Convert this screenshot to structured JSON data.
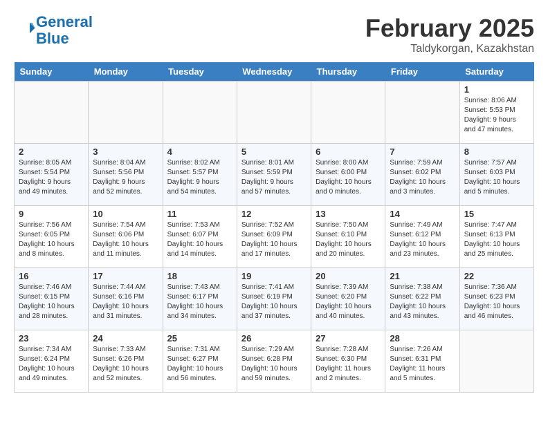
{
  "logo": {
    "line1": "General",
    "line2": "Blue"
  },
  "title": "February 2025",
  "subtitle": "Taldykorgan, Kazakhstan",
  "days_of_week": [
    "Sunday",
    "Monday",
    "Tuesday",
    "Wednesday",
    "Thursday",
    "Friday",
    "Saturday"
  ],
  "weeks": [
    [
      {
        "num": "",
        "info": ""
      },
      {
        "num": "",
        "info": ""
      },
      {
        "num": "",
        "info": ""
      },
      {
        "num": "",
        "info": ""
      },
      {
        "num": "",
        "info": ""
      },
      {
        "num": "",
        "info": ""
      },
      {
        "num": "1",
        "info": "Sunrise: 8:06 AM\nSunset: 5:53 PM\nDaylight: 9 hours and 47 minutes."
      }
    ],
    [
      {
        "num": "2",
        "info": "Sunrise: 8:05 AM\nSunset: 5:54 PM\nDaylight: 9 hours and 49 minutes."
      },
      {
        "num": "3",
        "info": "Sunrise: 8:04 AM\nSunset: 5:56 PM\nDaylight: 9 hours and 52 minutes."
      },
      {
        "num": "4",
        "info": "Sunrise: 8:02 AM\nSunset: 5:57 PM\nDaylight: 9 hours and 54 minutes."
      },
      {
        "num": "5",
        "info": "Sunrise: 8:01 AM\nSunset: 5:59 PM\nDaylight: 9 hours and 57 minutes."
      },
      {
        "num": "6",
        "info": "Sunrise: 8:00 AM\nSunset: 6:00 PM\nDaylight: 10 hours and 0 minutes."
      },
      {
        "num": "7",
        "info": "Sunrise: 7:59 AM\nSunset: 6:02 PM\nDaylight: 10 hours and 3 minutes."
      },
      {
        "num": "8",
        "info": "Sunrise: 7:57 AM\nSunset: 6:03 PM\nDaylight: 10 hours and 5 minutes."
      }
    ],
    [
      {
        "num": "9",
        "info": "Sunrise: 7:56 AM\nSunset: 6:05 PM\nDaylight: 10 hours and 8 minutes."
      },
      {
        "num": "10",
        "info": "Sunrise: 7:54 AM\nSunset: 6:06 PM\nDaylight: 10 hours and 11 minutes."
      },
      {
        "num": "11",
        "info": "Sunrise: 7:53 AM\nSunset: 6:07 PM\nDaylight: 10 hours and 14 minutes."
      },
      {
        "num": "12",
        "info": "Sunrise: 7:52 AM\nSunset: 6:09 PM\nDaylight: 10 hours and 17 minutes."
      },
      {
        "num": "13",
        "info": "Sunrise: 7:50 AM\nSunset: 6:10 PM\nDaylight: 10 hours and 20 minutes."
      },
      {
        "num": "14",
        "info": "Sunrise: 7:49 AM\nSunset: 6:12 PM\nDaylight: 10 hours and 23 minutes."
      },
      {
        "num": "15",
        "info": "Sunrise: 7:47 AM\nSunset: 6:13 PM\nDaylight: 10 hours and 25 minutes."
      }
    ],
    [
      {
        "num": "16",
        "info": "Sunrise: 7:46 AM\nSunset: 6:15 PM\nDaylight: 10 hours and 28 minutes."
      },
      {
        "num": "17",
        "info": "Sunrise: 7:44 AM\nSunset: 6:16 PM\nDaylight: 10 hours and 31 minutes."
      },
      {
        "num": "18",
        "info": "Sunrise: 7:43 AM\nSunset: 6:17 PM\nDaylight: 10 hours and 34 minutes."
      },
      {
        "num": "19",
        "info": "Sunrise: 7:41 AM\nSunset: 6:19 PM\nDaylight: 10 hours and 37 minutes."
      },
      {
        "num": "20",
        "info": "Sunrise: 7:39 AM\nSunset: 6:20 PM\nDaylight: 10 hours and 40 minutes."
      },
      {
        "num": "21",
        "info": "Sunrise: 7:38 AM\nSunset: 6:22 PM\nDaylight: 10 hours and 43 minutes."
      },
      {
        "num": "22",
        "info": "Sunrise: 7:36 AM\nSunset: 6:23 PM\nDaylight: 10 hours and 46 minutes."
      }
    ],
    [
      {
        "num": "23",
        "info": "Sunrise: 7:34 AM\nSunset: 6:24 PM\nDaylight: 10 hours and 49 minutes."
      },
      {
        "num": "24",
        "info": "Sunrise: 7:33 AM\nSunset: 6:26 PM\nDaylight: 10 hours and 52 minutes."
      },
      {
        "num": "25",
        "info": "Sunrise: 7:31 AM\nSunset: 6:27 PM\nDaylight: 10 hours and 56 minutes."
      },
      {
        "num": "26",
        "info": "Sunrise: 7:29 AM\nSunset: 6:28 PM\nDaylight: 10 hours and 59 minutes."
      },
      {
        "num": "27",
        "info": "Sunrise: 7:28 AM\nSunset: 6:30 PM\nDaylight: 11 hours and 2 minutes."
      },
      {
        "num": "28",
        "info": "Sunrise: 7:26 AM\nSunset: 6:31 PM\nDaylight: 11 hours and 5 minutes."
      },
      {
        "num": "",
        "info": ""
      }
    ]
  ]
}
